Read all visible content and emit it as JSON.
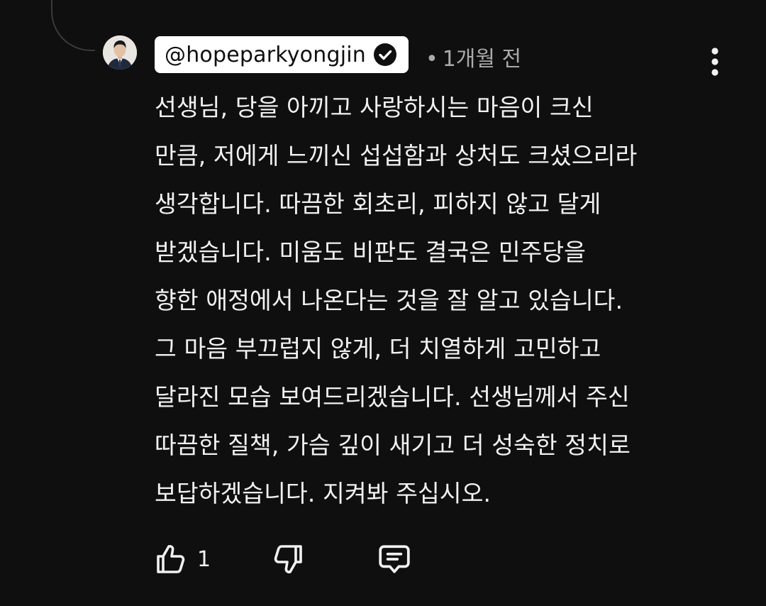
{
  "comment": {
    "author": "@hopeparkyongjin",
    "verified": true,
    "separator": "•",
    "timestamp": "1개월 전",
    "lines": [
      "선생님, 당을 아끼고 사랑하시는 마음이 크신",
      "만큼, 저에게 느끼신 섭섭함과 상처도 크셨으리라",
      "생각합니다. 따끔한 회초리, 피하지 않고 달게",
      "받겠습니다. 미움도 비판도 결국은 민주당을",
      "향한 애정에서 나온다는 것을 잘 알고 있습니다.",
      "그 마음 부끄럽지 않게, 더 치열하게 고민하고",
      "달라진 모습 보여드리겠습니다. 선생님께서 주신",
      "따끔한 질책, 가슴 깊이 새기고 더 성숙한 정치로",
      "보답하겠습니다. 지켜봐 주십시오."
    ],
    "like_count": "1"
  },
  "icons": {
    "avatar": "profile-photo",
    "verified": "verified-check-icon",
    "more": "more-vertical-icon",
    "like": "thumb-up-icon",
    "dislike": "thumb-down-icon",
    "reply": "reply-comment-icon"
  },
  "colors": {
    "background": "#0f0f0f",
    "text": "#f1f1f1",
    "secondary_text": "#aaaaaa",
    "author_chip_bg": "#ffffff",
    "author_chip_text": "#0f0f0f"
  }
}
